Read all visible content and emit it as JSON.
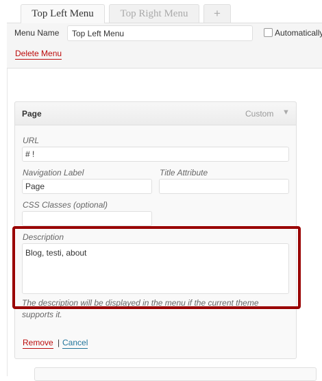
{
  "tabs": [
    {
      "label": "Top Left Menu",
      "active": true
    },
    {
      "label": "Top Right Menu",
      "active": false
    },
    {
      "label": "+",
      "active": false
    }
  ],
  "menu_header": {
    "menu_name_label": "Menu Name",
    "menu_name_value": "Top Left Menu",
    "auto_add_label": "Automatically",
    "auto_add_checked": false,
    "delete_menu_label": "Delete Menu"
  },
  "menu_item": {
    "title": "Page",
    "type": "Custom",
    "arrow": "▼",
    "url_label": "URL",
    "url_value": "# !",
    "nav_label_label": "Navigation Label",
    "nav_label_value": "Page",
    "title_attr_label": "Title Attribute",
    "title_attr_value": "",
    "css_classes_label": "CSS Classes (optional)",
    "css_classes_value": "",
    "description_label": "Description",
    "description_value": "Blog, testi, about",
    "description_help": "The description will be displayed in the menu if the current theme supports it.",
    "remove_label": "Remove",
    "separator": "|",
    "cancel_label": "Cancel"
  },
  "colors": {
    "highlight": "#990000",
    "delete_red": "#bc0b0b",
    "link_blue": "#21759b"
  }
}
